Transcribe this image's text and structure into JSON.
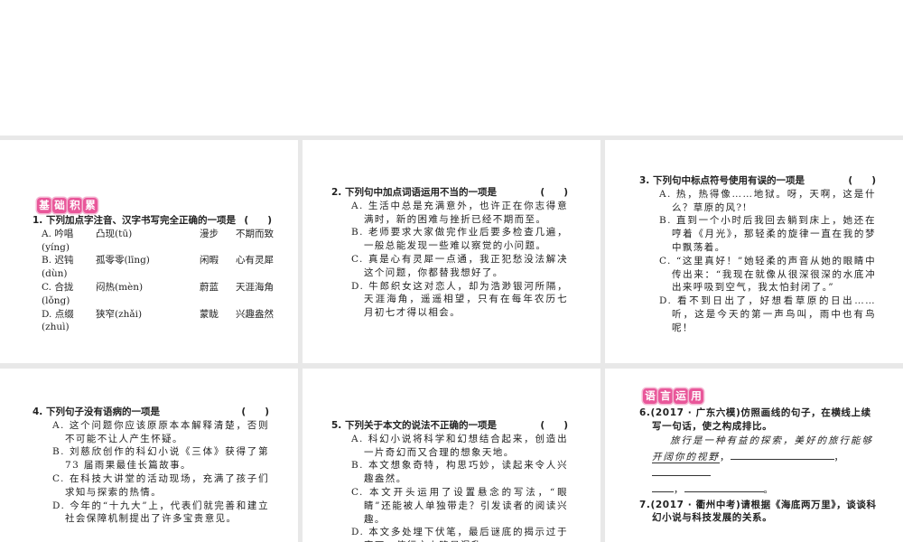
{
  "sections": {
    "basic": [
      "基",
      "础",
      "积",
      "累"
    ],
    "usage": [
      "语",
      "言",
      "运",
      "用"
    ]
  },
  "q1": {
    "stem": "1. 下列加点字注音、汉字书写完全正确的一项是",
    "paren": "(　　)",
    "rows": [
      [
        "A. 吟唱(yíng)",
        "凸现(tū)",
        "漫步",
        "不期而致"
      ],
      [
        "B. 迟钝(dùn)",
        "孤零零(līng)",
        "闲暇",
        "心有灵犀"
      ],
      [
        "C. 合拢(lǒng)",
        "闷热(mèn)",
        "蔚蓝",
        "天涯海角"
      ],
      [
        "D. 点缀(zhuì)",
        "狭窄(zhǎi)",
        "蒙眬",
        "兴趣盎然"
      ]
    ]
  },
  "q2": {
    "stem": "2. 下列句中加点词语运用不当的一项是",
    "paren": "(　　)",
    "options": [
      "A. 生活中总是充满意外，也许正在你志得意满时，新的困难与挫折已经不期而至。",
      "B. 老师要求大家做完作业后要多检查几遍，一般总能发现一些难以察觉的小问题。",
      "C. 真是心有灵犀一点通，我正犯愁没法解决这个问题，你都替我想好了。",
      "D. 牛郎织女这对恋人，却为浩渺银河所隔，天涯海角，遥遥相望，只有在每年农历七月初七才得以相会。"
    ]
  },
  "q3": {
    "stem": "3. 下列句中标点符号使用有误的一项是",
    "paren": "(　　)",
    "options": [
      "A. 热，热得像……地狱。呀，天啊，这是什么？草原的风?!",
      "B. 直到一个小时后我回去躺到床上，她还在哼着《月光》，那轻柔的旋律一直在我的梦中飘荡着。",
      "C. “这里真好！”她轻柔的声音从她的眼睛中传出来：“我现在就像从很深很深的水底冲出来呼吸到空气，我太怕封闭了。”",
      "D. 看不到日出了，好想看草原的日出……听，这是今天的第一声鸟叫，雨中也有鸟呢！"
    ]
  },
  "q4": {
    "stem": "4. 下列句子没有语病的一项是",
    "paren": "(　　)",
    "options": [
      "A. 这个问题你应该原原本本解释清楚，否则不可能不让人产生怀疑。",
      "B. 刘慈欣创作的科幻小说《三体》获得了第 73 届雨果最佳长篇故事。",
      "C. 在科技大讲堂的活动现场，充满了孩子们求知与探索的热情。",
      "D. 今年的“十九大”上，代表们就完善和建立社会保障机制提出了许多宝贵意见。"
    ]
  },
  "q5": {
    "stem": "5. 下列关于本文的说法不正确的一项是",
    "paren": "(　　)",
    "options": [
      "A. 科幻小说将科学和幻想结合起来，创造出一片奇幻而又合理的想象天地。",
      "B. 本文想象奇特，构思巧妙，读起来令人兴趣盎然。",
      "C. 本文开头运用了设置悬念的写法，“眼睛”还能被人单独带走？引发读者的阅读兴趣。",
      "D. 本文多处埋下伏笔，最后谜底的揭示过于突兀，使行文上略显混乱。"
    ]
  },
  "q6": {
    "stem": "6.(2017 · 广东六模)仿照画线的句子，在横线上续写一句话，使之构成排比。",
    "sentence_a": "旅行是一种有益的探索，美好的旅行能够",
    "sentence_b": "开阔你的视野",
    "comma": "，",
    "period": "。"
  },
  "q7": {
    "stem": "7.(2017 · 衢州中考)请根据《海底两万里》，谈谈科幻小说与科技发展的关系。"
  }
}
